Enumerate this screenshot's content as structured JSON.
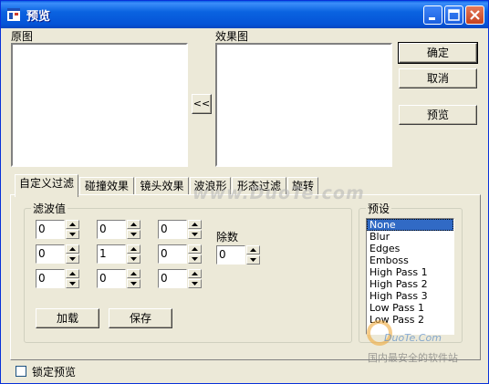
{
  "window": {
    "title": "预览"
  },
  "labels": {
    "original": "原图",
    "result": "效果图",
    "filter_values": "滤波值",
    "divisor": "除数",
    "presets": "预设"
  },
  "buttons": {
    "ok": "确定",
    "cancel": "取消",
    "preview": "预览",
    "copy_back": "<<",
    "load": "加载",
    "save": "保存"
  },
  "tabs": [
    "自定义过滤",
    "碰撞效果",
    "镜头效果",
    "波浪形",
    "形态过滤",
    "旋转"
  ],
  "active_tab": 0,
  "matrix": [
    [
      "0",
      "0",
      "0"
    ],
    [
      "0",
      "1",
      "0"
    ],
    [
      "0",
      "0",
      "0"
    ]
  ],
  "divisor_value": "0",
  "presets": [
    "None",
    "Blur",
    "Edges",
    "Emboss",
    "High Pass 1",
    "High Pass 2",
    "High Pass 3",
    "Low Pass 1",
    "Low Pass 2"
  ],
  "selected_preset": "None",
  "lock_preview": {
    "label": "锁定预览",
    "checked": false
  },
  "watermarks": {
    "main": "www.DuoTe.com",
    "logo_site": "DuoTe.Com",
    "logo_text": "国内最安全的软件站"
  }
}
